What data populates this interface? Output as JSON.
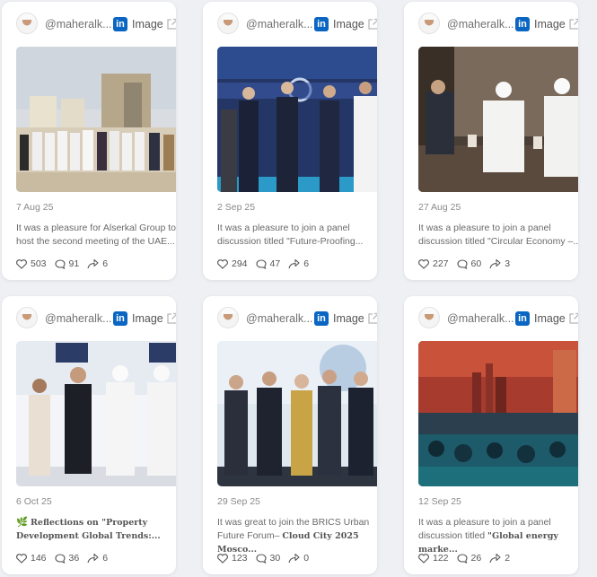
{
  "colors": {
    "linkedin": "#0a66c2",
    "page_bg": "#eef0f4",
    "card_bg": "#ffffff"
  },
  "icons": {
    "source": "linkedin-icon",
    "external": "external-link-icon",
    "likes": "heart-icon",
    "comments": "comment-icon",
    "shares": "share-icon"
  },
  "posts": [
    {
      "handle": "@maheralk...",
      "source_logo": "in",
      "type": "Image",
      "date": "7 Aug 25",
      "desc_line1": "It was a pleasure for Alserkal Group to",
      "desc_line2": "host the second meeting of the UAE...",
      "likes": "503",
      "comments": "91",
      "shares": "6"
    },
    {
      "handle": "@maheralk...",
      "source_logo": "in",
      "type": "Image",
      "date": "2 Sep 25",
      "desc_line1": "It was a pleasure to join a panel",
      "desc_line2": "discussion titled \"Future-Proofing...",
      "likes": "294",
      "comments": "47",
      "shares": "6"
    },
    {
      "handle": "@maheralk...",
      "source_logo": "in",
      "type": "Image",
      "date": "27 Aug 25",
      "desc_line1": "It was a pleasure to join a panel",
      "desc_line2": "discussion titled \"Circular Economy –...",
      "likes": "227",
      "comments": "60",
      "shares": "3"
    },
    {
      "handle": "@maheralk...",
      "source_logo": "in",
      "type": "Image",
      "date": "6 Oct 25",
      "desc_prefix": "🌿",
      "desc_line1": "Reflections on \"Property",
      "desc_line2": "Development Global Trends:...",
      "likes": "146",
      "comments": "36",
      "shares": "6"
    },
    {
      "handle": "@maheralk...",
      "source_logo": "in",
      "type": "Image",
      "date": "29 Sep 25",
      "desc_line1": "It was great to join the BRICS Urban",
      "desc_line2": "Future Forum–",
      "desc_line2_bold": "Cloud City 2025 Mosco...",
      "likes": "123",
      "comments": "30",
      "shares": "0"
    },
    {
      "handle": "@maheralk...",
      "source_logo": "in",
      "type": "Image",
      "date": "12 Sep 25",
      "desc_line1": "It was a pleasure to join a panel",
      "desc_line2": "discussion titled",
      "desc_line2_bold": "\"Global energy marke...",
      "likes": "122",
      "comments": "26",
      "shares": "2"
    }
  ]
}
